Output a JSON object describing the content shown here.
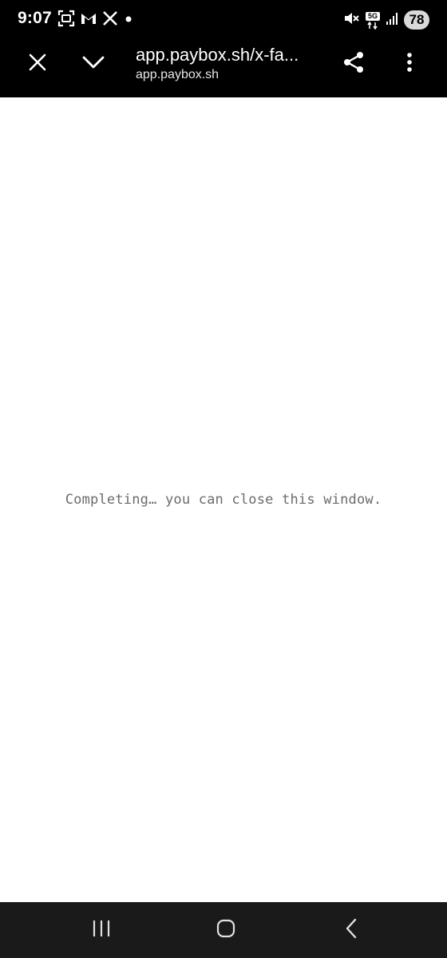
{
  "status_bar": {
    "time": "9:07",
    "left_icons": [
      "screenshot-icon",
      "gmail-icon",
      "x-app-icon",
      "notification-dot-icon"
    ],
    "right_icons": [
      "mute-icon",
      "network-5g-icon",
      "signal-icon"
    ],
    "network_label": "5G",
    "battery": "78"
  },
  "toolbar": {
    "url_title": "app.paybox.sh/x-fa...",
    "url_domain": "app.paybox.sh",
    "icons": [
      "close-icon",
      "chevron-down-icon",
      "share-icon",
      "more-vert-icon"
    ]
  },
  "page": {
    "message": "Completing… you can close this window."
  },
  "nav_bar": {
    "icons": [
      "recents-icon",
      "home-icon",
      "back-icon"
    ]
  }
}
